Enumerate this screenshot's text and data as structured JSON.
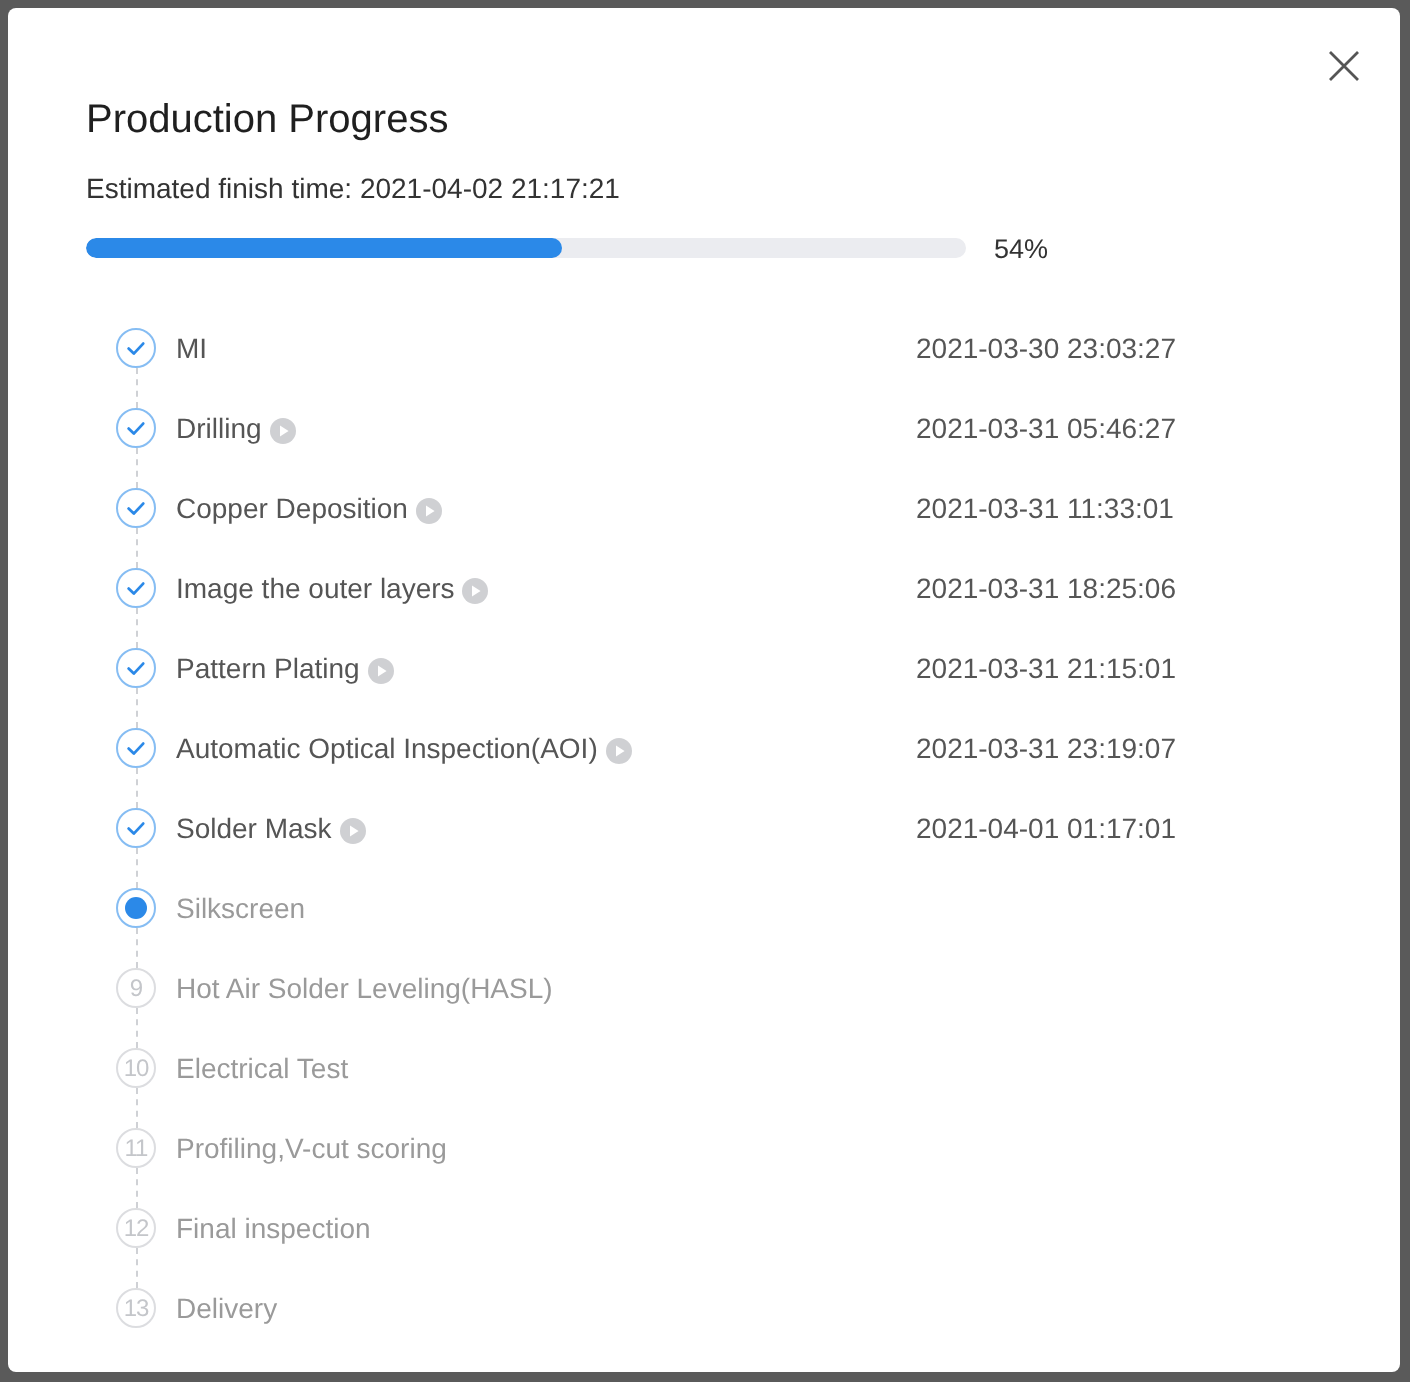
{
  "dialog": {
    "title": "Production Progress",
    "estimate": "Estimated finish time: 2021-04-02 21:17:21"
  },
  "progress": {
    "level": 0.54,
    "reading": "54%"
  },
  "steps": [
    {
      "kind": "done",
      "label": "MI",
      "detail_icon": false,
      "time": "2021-03-30 23:03:27"
    },
    {
      "kind": "done",
      "label": "Drilling",
      "detail_icon": true,
      "time": "2021-03-31 05:46:27"
    },
    {
      "kind": "done",
      "label": "Copper Deposition",
      "detail_icon": true,
      "time": "2021-03-31 11:33:01"
    },
    {
      "kind": "done",
      "label": "Image the outer layers",
      "detail_icon": true,
      "time": "2021-03-31 18:25:06"
    },
    {
      "kind": "done",
      "label": "Pattern Plating",
      "detail_icon": true,
      "time": "2021-03-31 21:15:01"
    },
    {
      "kind": "done",
      "label": "Automatic Optical Inspection(AOI)",
      "detail_icon": true,
      "time": "2021-03-31 23:19:07"
    },
    {
      "kind": "done",
      "label": "Solder Mask",
      "detail_icon": true,
      "time": "2021-04-01 01:17:01"
    },
    {
      "kind": "current",
      "label": "Silkscreen",
      "detail_icon": false
    },
    {
      "kind": "pending",
      "number": "9",
      "label": "Hot Air Solder Leveling(HASL)",
      "detail_icon": false
    },
    {
      "kind": "pending",
      "number": "10",
      "label": "Electrical Test",
      "detail_icon": false
    },
    {
      "kind": "pending",
      "number": "11",
      "label": "Profiling,V-cut scoring",
      "detail_icon": false
    },
    {
      "kind": "pending",
      "number": "12",
      "label": "Final inspection",
      "detail_icon": false
    },
    {
      "kind": "pending",
      "number": "13",
      "label": "Delivery",
      "detail_icon": false
    }
  ]
}
